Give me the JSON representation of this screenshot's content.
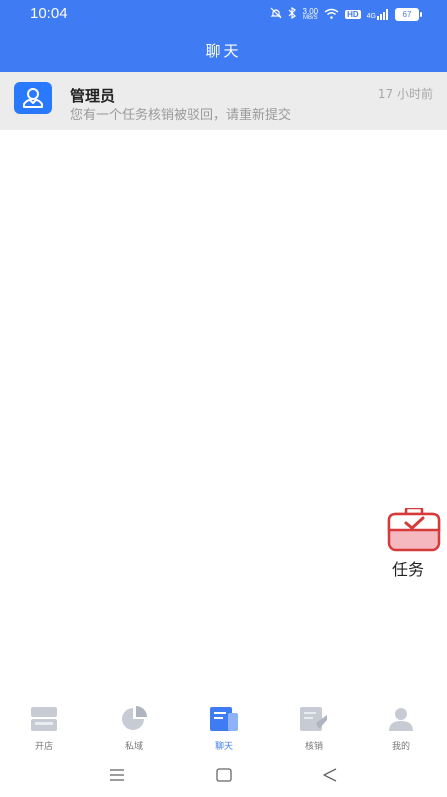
{
  "status": {
    "time": "10:04",
    "speed": "3.00",
    "speed_unit": "MB/S",
    "hd": "HD",
    "network": "4G",
    "battery": "67"
  },
  "header": {
    "title": "聊天"
  },
  "chat": {
    "name": "管理员",
    "time": "17 小时前",
    "message": "您有一个任务核销被驳回，请重新提交"
  },
  "floating": {
    "label": "任务"
  },
  "tabs": [
    {
      "label": "开店",
      "icon": "store-icon"
    },
    {
      "label": "私域",
      "icon": "pie-chart-icon"
    },
    {
      "label": "聊天",
      "icon": "chat-icon",
      "active": true
    },
    {
      "label": "核销",
      "icon": "verify-icon"
    },
    {
      "label": "我的",
      "icon": "profile-icon"
    }
  ],
  "colors": {
    "accent": "#3f7bf3",
    "avatar": "#2979ff",
    "task_red": "#e23b3b"
  }
}
